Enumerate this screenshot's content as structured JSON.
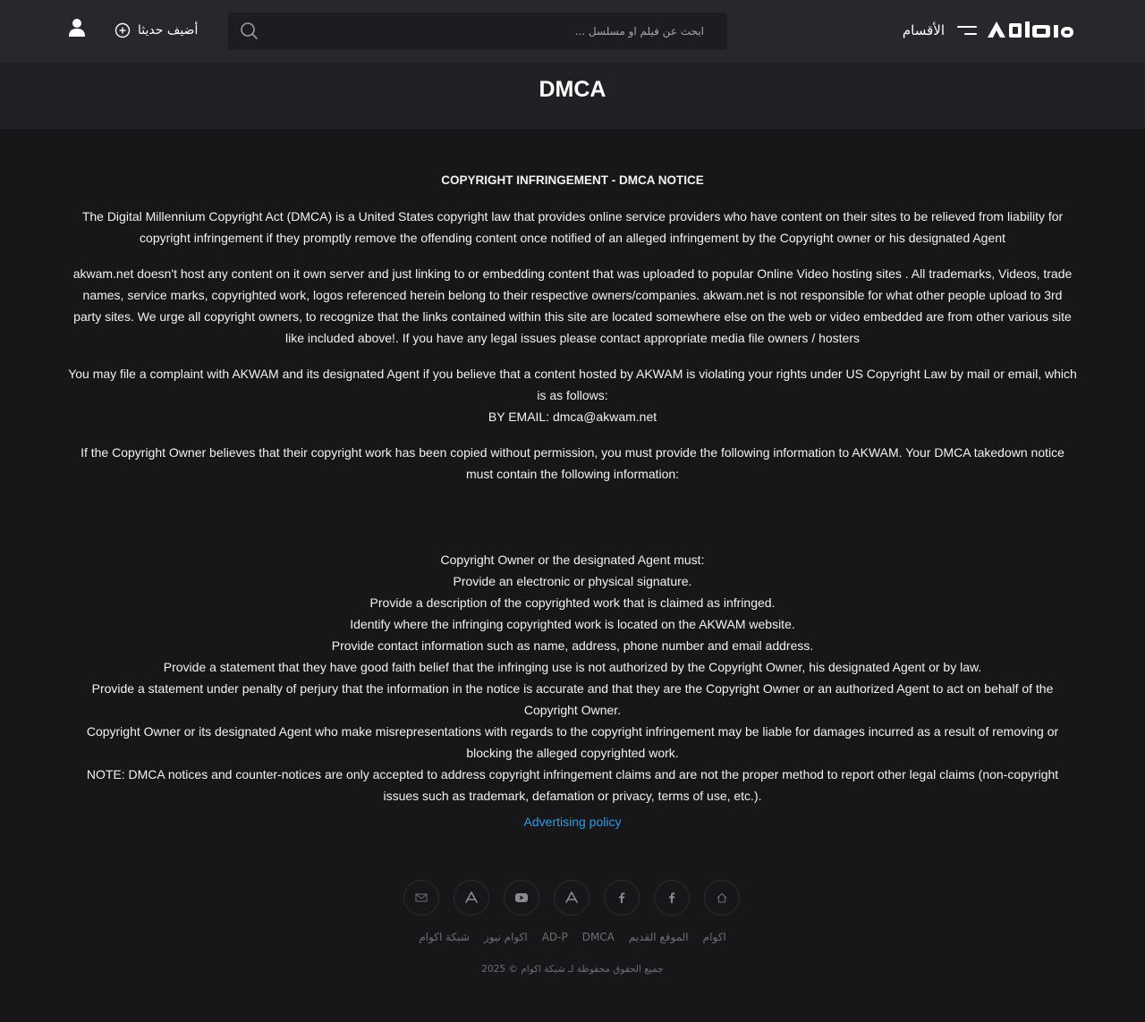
{
  "header": {
    "logo_text": "اكوام",
    "menu_label": "الأقسام",
    "search_placeholder": "ابحث عن فيلم او مسلسل ...",
    "add_new_label": "أضيف حديثا"
  },
  "page": {
    "title": "DMCA"
  },
  "content": {
    "heading": "COPYRIGHT INFRINGEMENT - DMCA NOTICE",
    "p1": "The Digital Millennium Copyright Act (DMCA) is a United States copyright law that provides online service providers who have content on their sites to be relieved from liability for copyright infringement if they promptly remove the offending content once notified of an alleged infringement by the Copyright owner or his designated Agent",
    "p2": "akwam.net doesn't host any content on it own server and just linking to or embedding content that was uploaded to popular Online Video hosting sites . All trademarks, Videos, trade names, service marks, copyrighted work, logos referenced herein belong to their respective owners/companies. akwam.net is not responsible for what other people upload to 3rd party sites. We urge all copyright owners, to recognize that the links contained within this site are located somewhere else on the web or video embedded are from other various site like included above!. If you have any legal issues please contact appropriate media file owners / hosters",
    "p3": "You may file a complaint with AKWAM and its designated Agent if you believe that a content hosted by AKWAM is violating your rights under US Copyright Law by mail or email, which is as follows:",
    "p3_email": "BY EMAIL: dmca@akwam.net",
    "p4": "If the Copyright Owner believes that their copyright work has been copied without permission, you must provide the following information to AKWAM.  Your DMCA takedown notice must contain the following information:",
    "requirements": [
      "Copyright Owner or the designated Agent must:",
      "Provide an electronic or physical signature.",
      "Provide a description of the copyrighted work that is claimed as infringed.",
      "Identify where the infringing copyrighted work is located on the AKWAM website.",
      "Provide contact information such as name, address, phone number and email address.",
      "Provide a statement that they have good faith belief that the infringing use is not authorized by the Copyright Owner, his designated Agent or by law.",
      "Provide a statement under penalty of perjury that the information in the notice is accurate and that they are the Copyright Owner or an authorized Agent to act on behalf of the Copyright Owner.",
      "Copyright Owner or its designated Agent who make misrepresentations with regards to the copyright infringement may be liable for damages incurred as a result of removing or blocking the alleged copyrighted work.",
      "NOTE: DMCA notices and counter-notices are only accepted to address copyright infringement claims and are not the proper method to report other legal claims (non-copyright issues such as trademark, defamation or privacy, terms of use, etc.)."
    ],
    "advertising_link": "Advertising policy"
  },
  "footer": {
    "social_icons": [
      "mail-icon",
      "app-store-icon",
      "youtube-icon",
      "app-store-icon",
      "facebook-icon",
      "facebook-icon",
      "home-icon"
    ],
    "links": [
      "اكوام",
      "الموقع القديم",
      "DMCA",
      "AD-P",
      "اكوام نيوز",
      "شبكة اكوام"
    ],
    "copyright": "جميع الحقوق محفوظة لـ شبكة اكوام © 2025"
  },
  "colors": {
    "background": "#171719",
    "header": "#27272c",
    "title_band": "#202025",
    "link": "#2f9be3",
    "footer_text": "#6e6e75"
  }
}
